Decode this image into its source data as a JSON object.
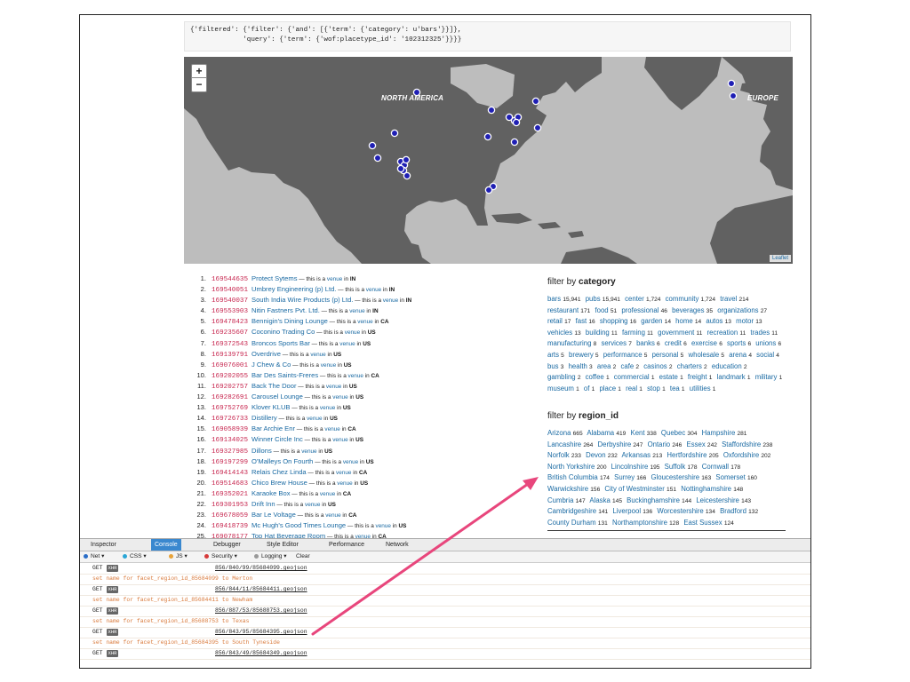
{
  "query_text": "{'filtered': {'filter': {'and': [{'term': {'category': u'bars'}}]},\n             'query': {'term': {'wof:placetype_id': '102312325'}}}}",
  "map": {
    "zoom_in": "+",
    "zoom_out": "−",
    "label_na": "NORTH AMERICA",
    "label_eu": "EUROPE",
    "attribution": "Leaflet",
    "colors": {
      "water": "#bdbdbd",
      "land": "#616161",
      "marker": "#1f1fb4"
    }
  },
  "venues": [
    {
      "rank": "1.",
      "id": "169544635",
      "name": "Protect Sytems",
      "country": "IN"
    },
    {
      "rank": "2.",
      "id": "169540051",
      "name": "Umbrey Engineering (p) Ltd.",
      "country": "IN"
    },
    {
      "rank": "3.",
      "id": "169540037",
      "name": "South India Wire Products (p) Ltd.",
      "country": "IN"
    },
    {
      "rank": "4.",
      "id": "169553903",
      "name": "Nitin Fastners Pvt. Ltd.",
      "country": "IN"
    },
    {
      "rank": "5.",
      "id": "169478423",
      "name": "Bennigin's Dining Lounge",
      "country": "CA"
    },
    {
      "rank": "6.",
      "id": "169235607",
      "name": "Coconino Trading Co",
      "country": "US"
    },
    {
      "rank": "7.",
      "id": "169372543",
      "name": "Broncos Sports Bar",
      "country": "US"
    },
    {
      "rank": "8.",
      "id": "169139791",
      "name": "Overdrive",
      "country": "US"
    },
    {
      "rank": "9.",
      "id": "169076001",
      "name": "J Chew & Co",
      "country": "US"
    },
    {
      "rank": "10.",
      "id": "169202055",
      "name": "Bar Des Saints-Freres",
      "country": "CA"
    },
    {
      "rank": "11.",
      "id": "169202757",
      "name": "Back The Door",
      "country": "US"
    },
    {
      "rank": "12.",
      "id": "169282691",
      "name": "Carousel Lounge",
      "country": "US"
    },
    {
      "rank": "13.",
      "id": "169752769",
      "name": "Klover KLUB",
      "country": "US"
    },
    {
      "rank": "14.",
      "id": "169726733",
      "name": "Distillery",
      "country": "US"
    },
    {
      "rank": "15.",
      "id": "169058939",
      "name": "Bar Archie Enr",
      "country": "CA"
    },
    {
      "rank": "16.",
      "id": "169134025",
      "name": "Winner Circle Inc",
      "country": "US"
    },
    {
      "rank": "17.",
      "id": "169327985",
      "name": "Dillons",
      "country": "US"
    },
    {
      "rank": "18.",
      "id": "169197299",
      "name": "O'Malleys On Fourth",
      "country": "US"
    },
    {
      "rank": "19.",
      "id": "169414143",
      "name": "Relais Chez Linda",
      "country": "CA"
    },
    {
      "rank": "20.",
      "id": "169514683",
      "name": "Chico Brew House",
      "country": "US"
    },
    {
      "rank": "21.",
      "id": "169352021",
      "name": "Karaoke Box",
      "country": "CA"
    },
    {
      "rank": "22.",
      "id": "169301953",
      "name": "Drift Inn",
      "country": "US"
    },
    {
      "rank": "23.",
      "id": "169678059",
      "name": "Bar Le Voltage",
      "country": "CA"
    },
    {
      "rank": "24.",
      "id": "169418739",
      "name": "Mc Hugh's Good Times Lounge",
      "country": "US"
    },
    {
      "rank": "25.",
      "id": "169078177",
      "name": "Top Hat Beverage Room",
      "country": "CA"
    }
  ],
  "venue_labels": {
    "dash": " — this is a ",
    "venue": "venue",
    "in": " in "
  },
  "filter_category": {
    "prefix": "filter by ",
    "field": "category",
    "items": [
      {
        "label": "bars",
        "count": "15,941"
      },
      {
        "label": "pubs",
        "count": "15,941"
      },
      {
        "label": "center",
        "count": "1,724"
      },
      {
        "label": "community",
        "count": "1,724"
      },
      {
        "label": "travel",
        "count": "214"
      },
      {
        "label": "restaurant",
        "count": "171"
      },
      {
        "label": "food",
        "count": "51"
      },
      {
        "label": "professional",
        "count": "46"
      },
      {
        "label": "beverages",
        "count": "35"
      },
      {
        "label": "organizations",
        "count": "27"
      },
      {
        "label": "retail",
        "count": "17"
      },
      {
        "label": "fast",
        "count": "16"
      },
      {
        "label": "shopping",
        "count": "16"
      },
      {
        "label": "garden",
        "count": "14"
      },
      {
        "label": "home",
        "count": "14"
      },
      {
        "label": "autos",
        "count": "13"
      },
      {
        "label": "motor",
        "count": "13"
      },
      {
        "label": "vehicles",
        "count": "13"
      },
      {
        "label": "building",
        "count": "11"
      },
      {
        "label": "farming",
        "count": "11"
      },
      {
        "label": "government",
        "count": "11"
      },
      {
        "label": "recreation",
        "count": "11"
      },
      {
        "label": "trades",
        "count": "11"
      },
      {
        "label": "manufacturing",
        "count": "8"
      },
      {
        "label": "services",
        "count": "7"
      },
      {
        "label": "banks",
        "count": "6"
      },
      {
        "label": "credit",
        "count": "6"
      },
      {
        "label": "exercise",
        "count": "6"
      },
      {
        "label": "sports",
        "count": "6"
      },
      {
        "label": "unions",
        "count": "6"
      },
      {
        "label": "arts",
        "count": "5"
      },
      {
        "label": "brewery",
        "count": "5"
      },
      {
        "label": "performance",
        "count": "5"
      },
      {
        "label": "personal",
        "count": "5"
      },
      {
        "label": "wholesale",
        "count": "5"
      },
      {
        "label": "arena",
        "count": "4"
      },
      {
        "label": "social",
        "count": "4"
      },
      {
        "label": "bus",
        "count": "3"
      },
      {
        "label": "health",
        "count": "3"
      },
      {
        "label": "area",
        "count": "2"
      },
      {
        "label": "cafe",
        "count": "2"
      },
      {
        "label": "casinos",
        "count": "2"
      },
      {
        "label": "charters",
        "count": "2"
      },
      {
        "label": "education",
        "count": "2"
      },
      {
        "label": "gambling",
        "count": "2"
      },
      {
        "label": "coffee",
        "count": "1"
      },
      {
        "label": "commercial",
        "count": "1"
      },
      {
        "label": "estate",
        "count": "1"
      },
      {
        "label": "freight",
        "count": "1"
      },
      {
        "label": "landmark",
        "count": "1"
      },
      {
        "label": "military",
        "count": "1"
      },
      {
        "label": "museum",
        "count": "1"
      },
      {
        "label": "of",
        "count": "1"
      },
      {
        "label": "place",
        "count": "1"
      },
      {
        "label": "real",
        "count": "1"
      },
      {
        "label": "stop",
        "count": "1"
      },
      {
        "label": "tea",
        "count": "1"
      },
      {
        "label": "utilities",
        "count": "1"
      }
    ]
  },
  "filter_region": {
    "prefix": "filter by ",
    "field": "region_id",
    "items": [
      {
        "label": "Arizona",
        "count": "665"
      },
      {
        "label": "Alabama",
        "count": "419"
      },
      {
        "label": "Kent",
        "count": "338"
      },
      {
        "label": "Quebec",
        "count": "304"
      },
      {
        "label": "Hampshire",
        "count": "281"
      },
      {
        "label": "Lancashire",
        "count": "264"
      },
      {
        "label": "Derbyshire",
        "count": "247"
      },
      {
        "label": "Ontario",
        "count": "246"
      },
      {
        "label": "Essex",
        "count": "242"
      },
      {
        "label": "Staffordshire",
        "count": "238"
      },
      {
        "label": "Norfolk",
        "count": "233"
      },
      {
        "label": "Devon",
        "count": "232"
      },
      {
        "label": "Arkansas",
        "count": "213"
      },
      {
        "label": "Hertfordshire",
        "count": "205"
      },
      {
        "label": "Oxfordshire",
        "count": "202"
      },
      {
        "label": "North Yorkshire",
        "count": "200"
      },
      {
        "label": "Lincolnshire",
        "count": "195"
      },
      {
        "label": "Suffolk",
        "count": "178"
      },
      {
        "label": "Cornwall",
        "count": "178"
      },
      {
        "label": "British Columbia",
        "count": "174"
      },
      {
        "label": "Surrey",
        "count": "166"
      },
      {
        "label": "Gloucestershire",
        "count": "163"
      },
      {
        "label": "Somerset",
        "count": "160"
      },
      {
        "label": "Warwickshire",
        "count": "156"
      },
      {
        "label": "City of Westminster",
        "count": "151"
      },
      {
        "label": "Nottinghamshire",
        "count": "148"
      },
      {
        "label": "Cumbria",
        "count": "147"
      },
      {
        "label": "Alaska",
        "count": "145"
      },
      {
        "label": "Buckinghamshire",
        "count": "144"
      },
      {
        "label": "Leicestershire",
        "count": "143"
      },
      {
        "label": "Cambridgeshire",
        "count": "141"
      },
      {
        "label": "Liverpool",
        "count": "136"
      },
      {
        "label": "Worcestershire",
        "count": "134"
      },
      {
        "label": "Bradford",
        "count": "132"
      },
      {
        "label": "County Durham",
        "count": "131"
      },
      {
        "label": "Northamptonshire",
        "count": "128"
      },
      {
        "label": "East Sussex",
        "count": "124"
      }
    ]
  },
  "devtools": {
    "tabs": [
      "Inspector",
      "Console",
      "Debugger",
      "Style Editor",
      "Performance",
      "Network"
    ],
    "active_tab": "Console",
    "filters": [
      {
        "label": "Net",
        "color": "#2a6ec8"
      },
      {
        "label": "CSS",
        "color": "#2aa6d6"
      },
      {
        "label": "JS",
        "color": "#e8a33a"
      },
      {
        "label": "Security",
        "color": "#d63a3a"
      },
      {
        "label": "Logging",
        "color": "#999999"
      }
    ],
    "clear": "Clear",
    "console_rows": [
      {
        "type": "get",
        "text": "GET",
        "badge": "XHR",
        "url": "856/840/99/85684099.geojson"
      },
      {
        "type": "msg",
        "text": "set name for facet_region_id_85684099 to Merton"
      },
      {
        "type": "get",
        "text": "GET",
        "badge": "XHR",
        "url": "856/844/11/85684411.geojson"
      },
      {
        "type": "msg",
        "text": "set name for facet_region_id_85684411 to Newham"
      },
      {
        "type": "get",
        "text": "GET",
        "badge": "XHR",
        "url": "856/887/53/85688753.geojson"
      },
      {
        "type": "msg",
        "text": "set name for facet_region_id_85688753 to Texas"
      },
      {
        "type": "get",
        "text": "GET",
        "badge": "XHR",
        "url": "856/843/95/85684395.geojson"
      },
      {
        "type": "msg",
        "text": "set name for facet_region_id_85684395 to South Tyneside"
      },
      {
        "type": "get",
        "text": "GET",
        "badge": "XHR",
        "url": "856/843/49/85684349.geojson"
      }
    ]
  },
  "annotation_arrow_color": "#e8467c"
}
